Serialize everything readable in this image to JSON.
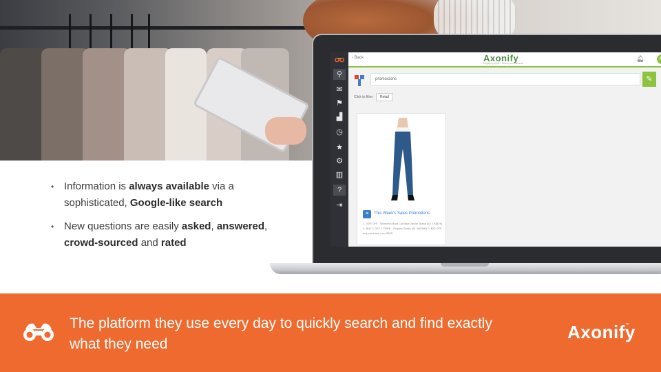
{
  "bullets": [
    {
      "parts": [
        {
          "text": "Information is ",
          "bold": false
        },
        {
          "text": "always available",
          "bold": true
        },
        {
          "text": " via a sophisticated, ",
          "bold": false
        },
        {
          "text": "Google-like search",
          "bold": true
        }
      ]
    },
    {
      "parts": [
        {
          "text": "New questions are easily ",
          "bold": false
        },
        {
          "text": "asked",
          "bold": true
        },
        {
          "text": ", ",
          "bold": false
        },
        {
          "text": "answered",
          "bold": true
        },
        {
          "text": ", ",
          "bold": false
        },
        {
          "text": "crowd-sourced",
          "bold": true
        },
        {
          "text": " and ",
          "bold": false
        },
        {
          "text": "rated",
          "bold": true
        }
      ]
    }
  ],
  "bullet_marker": "•",
  "app": {
    "back_label": "‹ Back",
    "logo": "Axonify",
    "tagline": "Engage people • Move your business",
    "avatar": "AB",
    "search_value": "promocions",
    "filter_label": "Click to filter:",
    "filter_chip": "Retail",
    "card_title": "This Week's Sales Promotions",
    "card_text": "1. 25% OFF - Women's Boot Cut Blue Denim Jeans (ID: 193829) 2. BUY 1 GET 1 FREE - Graphic Socks (ID: 583380) 3. $20 OFF any purchase over $150"
  },
  "footer": {
    "tagline": "The platform they use every day to quickly search and find exactly what they need",
    "logo": "Axonify",
    "tm": "™"
  },
  "colors": {
    "accent_orange": "#ee6a2f",
    "app_green": "#8cc43f",
    "app_sidebar": "#303136"
  },
  "icons": [
    "binoculars-icon",
    "search-icon",
    "chat-icon",
    "flag-icon",
    "chart-icon",
    "star-icon",
    "gear-icon",
    "logout-icon",
    "bell-icon"
  ]
}
